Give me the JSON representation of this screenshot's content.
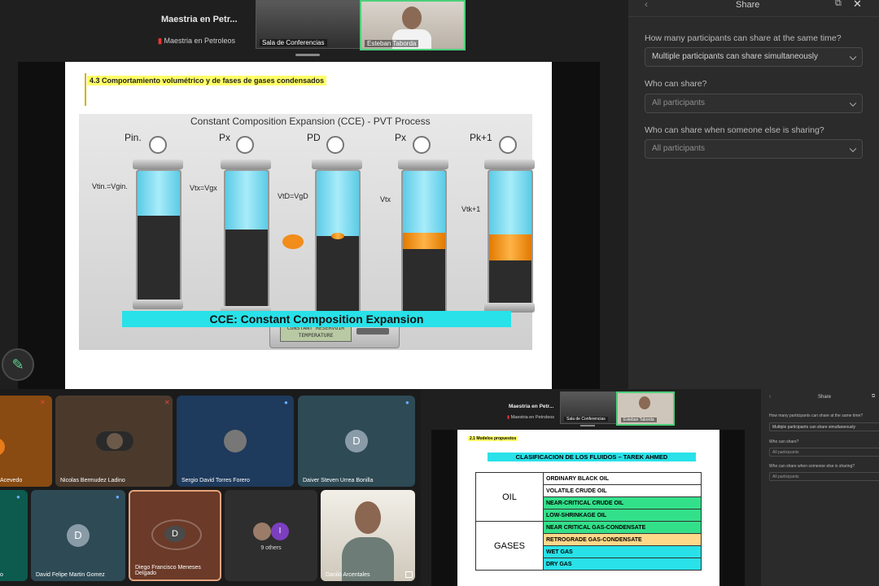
{
  "top_meeting": {
    "meeting_title": "Maestria en Petr...",
    "meeting_subtitle": "Maestria en Petroleos",
    "room_thumb_label": "Sala de Conferencias",
    "presenter_label": "Esteban Taborda"
  },
  "share_panel": {
    "title": "Share",
    "q1": "How many participants can share at the same time?",
    "q1_value": "Multiple participants can share simultaneously",
    "q2": "Who can share?",
    "q2_value": "All participants",
    "q3": "Who can share when someone else is sharing?",
    "q3_value": "All participants"
  },
  "slide": {
    "section_title": "4.3 Comportamiento volumétrico y de fases de gases condensados",
    "diagram_title": "Constant Composition Expansion (CCE) - PVT Process",
    "pressures": [
      "Pin.",
      "Px",
      "PD",
      "Px",
      "Pk+1"
    ],
    "volumes": [
      "Vtin.=Vgin.",
      "Vtx=Vgx",
      "VtD=VgD",
      "Vtx",
      "Vtk+1"
    ],
    "controller_text": "CONSTANT RESERVOIR TEMPERATURE",
    "banner": "CCE: Constant Composition Expansion"
  },
  "participants": [
    {
      "name": "Acevedo"
    },
    {
      "name": "Nicolas Bermudez Ladino"
    },
    {
      "name": "Sergio David Torres Forero"
    },
    {
      "name": "Daiver Steven Urrea Bonilla",
      "initial": "D"
    },
    {
      "name": "o"
    },
    {
      "name": "David Felipe Martin Gomez",
      "initial": "D"
    },
    {
      "name": "Diego Francisco Meneses Delgado",
      "initial": "D"
    },
    {
      "name": "9 others",
      "initial": "I"
    },
    {
      "name": "Danilo Arcentales"
    }
  ],
  "mini": {
    "meeting_title": "Maestria en Petr...",
    "meeting_subtitle": "Maestria en Petroleos",
    "room_label": "Sala de Conferencias",
    "presenter_label": "Esteban Taborda",
    "share_title": "Share",
    "q1": "How many participants can share at the same time?",
    "q1_value": "Multiple participants can share simultaneously",
    "q2": "Who can share?",
    "q2_value": "All participants",
    "q3": "Who can share when someone else is sharing?",
    "q3_value": "All participants",
    "slide_section": "2.1 Modelos propuestos",
    "slide_title": "CLASIFICACION DE LOS FLUIDOS – TAREK AHMED",
    "oil_label": "OIL",
    "gases_label": "GASES",
    "oil_rows": [
      "ORDINARY BLACK OIL",
      "VOLATILE CRUDE OIL",
      "NEAR-CRITICAL CRUDE OIL",
      "LOW-SHRINKAGE OIL"
    ],
    "gas_rows": [
      "NEAR CRITICAL GAS-CONDENSATE",
      "RETROGRADE GAS-CONDENSATE",
      "WET GAS",
      "DRY GAS"
    ]
  },
  "colors": {
    "accent_green": "#4ccf7a",
    "cyan": "#29e1e8",
    "row_green": "#33e08a",
    "row_yellow": "#ffd98a"
  }
}
